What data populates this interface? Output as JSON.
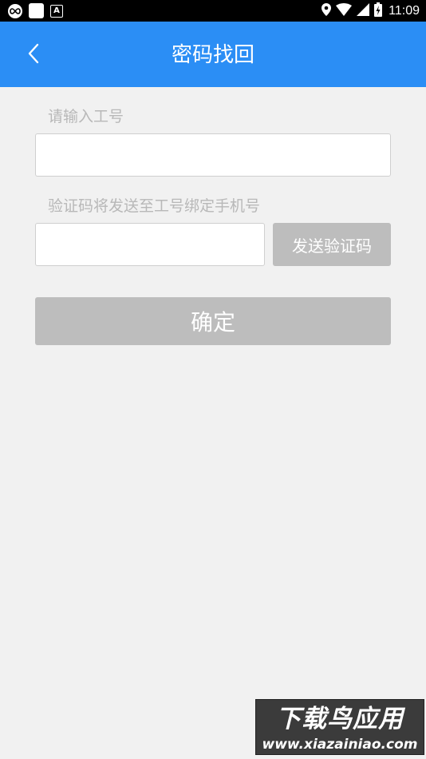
{
  "status_bar": {
    "time": "11:09",
    "left_icons": [
      "infinity-app-icon",
      "square-notification-icon",
      "a-notification-icon"
    ],
    "right_icons": [
      "location-icon",
      "wifi-icon",
      "signal-icon",
      "battery-icon"
    ]
  },
  "header": {
    "title": "密码找回",
    "back_icon": "chevron-left-icon",
    "background": "#2b8ef5"
  },
  "form": {
    "employee_id_label": "请输入工号",
    "employee_id_value": "",
    "code_label": "验证码将发送至工号绑定手机号",
    "code_value": "",
    "send_code_label": "发送验证码",
    "confirm_label": "确定"
  },
  "watermark": {
    "line1": "下载鸟应用",
    "line2": "www.xiazainiao.com"
  },
  "colors": {
    "page_background": "#f1f1f1",
    "disabled_button": "#bdbdbd",
    "label_text": "#b8b8b8"
  }
}
